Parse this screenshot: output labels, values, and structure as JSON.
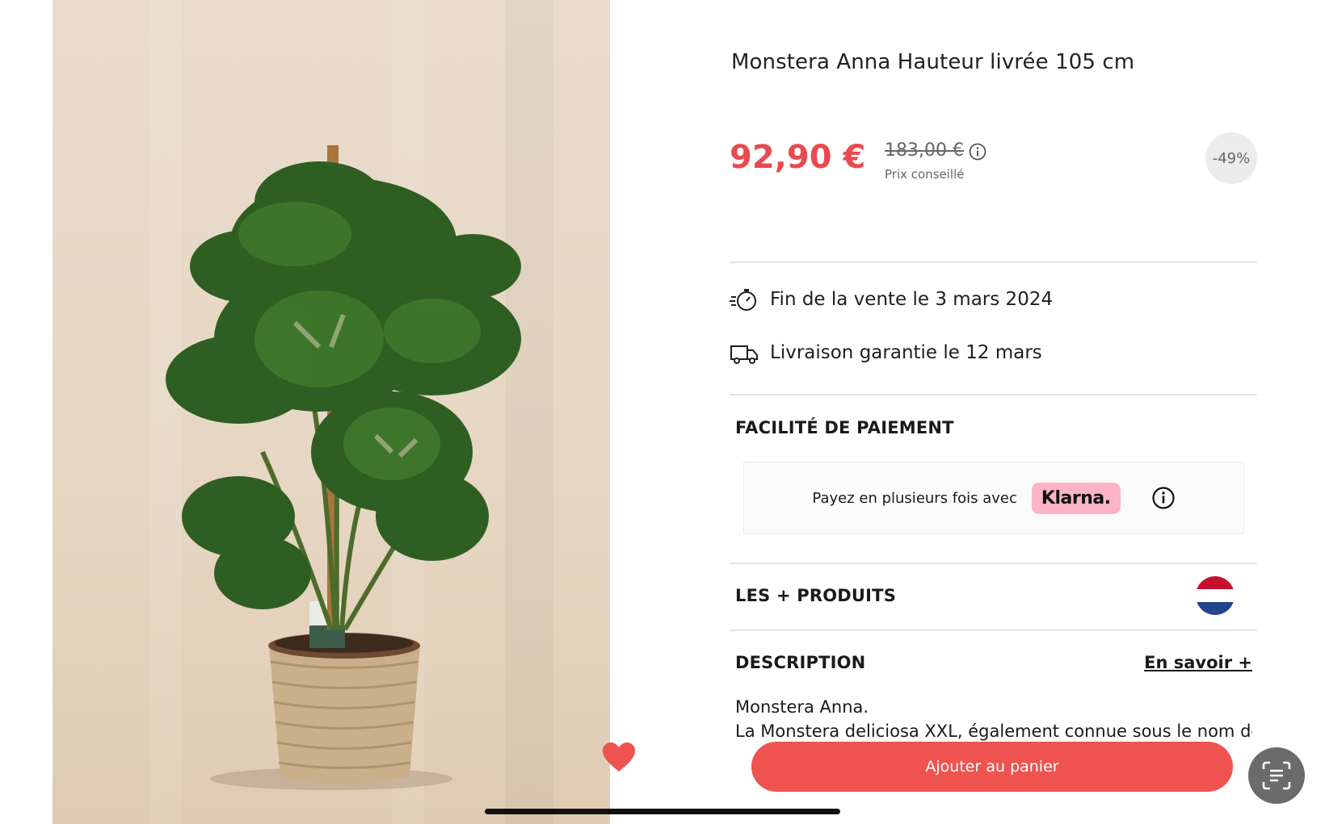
{
  "product": {
    "title": "Monstera Anna Hauteur livrée 105 cm",
    "price": "92,90 €",
    "old_price": "183,00 €",
    "price_label": "Prix conseillé",
    "discount": "-49%"
  },
  "info_rows": {
    "sale_end": "Fin de la vente le 3 mars 2024",
    "delivery": "Livraison garantie le 12 mars"
  },
  "payment": {
    "section_title": "FACILITÉ DE PAIEMENT",
    "text": "Payez en plusieurs fois avec",
    "provider": "Klarna."
  },
  "products_section": {
    "title": "LES + PRODUITS",
    "flag_colors": [
      "#c8102e",
      "#ffffff",
      "#21468b"
    ]
  },
  "description": {
    "title": "DESCRIPTION",
    "learn_more": "En savoir +",
    "line1": "Monstera Anna.",
    "line2": "La Monstera deliciosa XXL, également connue sous le nom de"
  },
  "cta": {
    "label": "Ajouter au panier"
  },
  "colors": {
    "accent": "#ef5350",
    "price": "#e94a4f",
    "klarna": "#ffb3c7"
  },
  "icons": [
    "heart-icon",
    "info-icon",
    "stopwatch-icon",
    "truck-icon",
    "scan-text-icon"
  ]
}
